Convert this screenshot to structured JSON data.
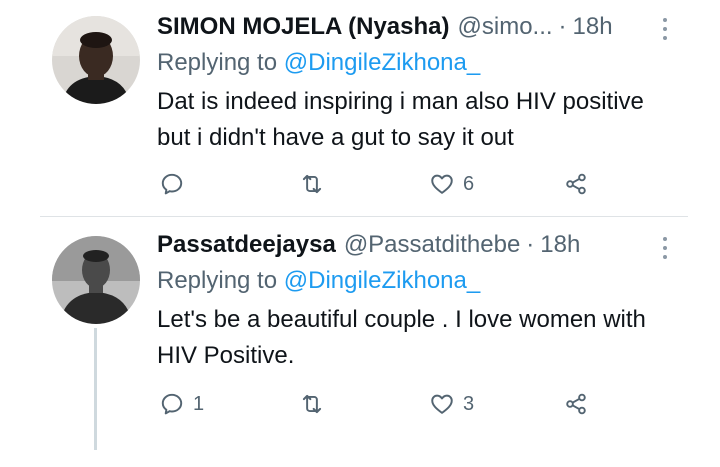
{
  "tweets": [
    {
      "author_name": "SIMON MOJELA (Nyasha)",
      "handle": "@simo...",
      "separator": "·",
      "time": "18h",
      "replying_prefix": "Replying to ",
      "replying_to": "@DingileZikhona_",
      "text": "Dat is indeed inspiring i man also HIV positive but i didn't have a gut to say it out",
      "reply_count": "",
      "retweet_count": "",
      "like_count": "6"
    },
    {
      "author_name": "Passatdeejaysa",
      "handle": "@Passatdithebe",
      "separator": "·",
      "time": "18h",
      "replying_prefix": "Replying to ",
      "replying_to": "@DingileZikhona_",
      "text": "Let's be a beautiful couple . I love women with HIV Positive.",
      "reply_count": "1",
      "retweet_count": "",
      "like_count": "3"
    }
  ],
  "icons": {
    "reply": "reply-icon",
    "retweet": "retweet-icon",
    "like": "heart-icon",
    "share": "share-icon",
    "more": "more-options-icon"
  },
  "colors": {
    "text": "#0f1419",
    "secondary": "#536471",
    "mention": "#1d9bf0",
    "divider": "#dfe3e6"
  }
}
